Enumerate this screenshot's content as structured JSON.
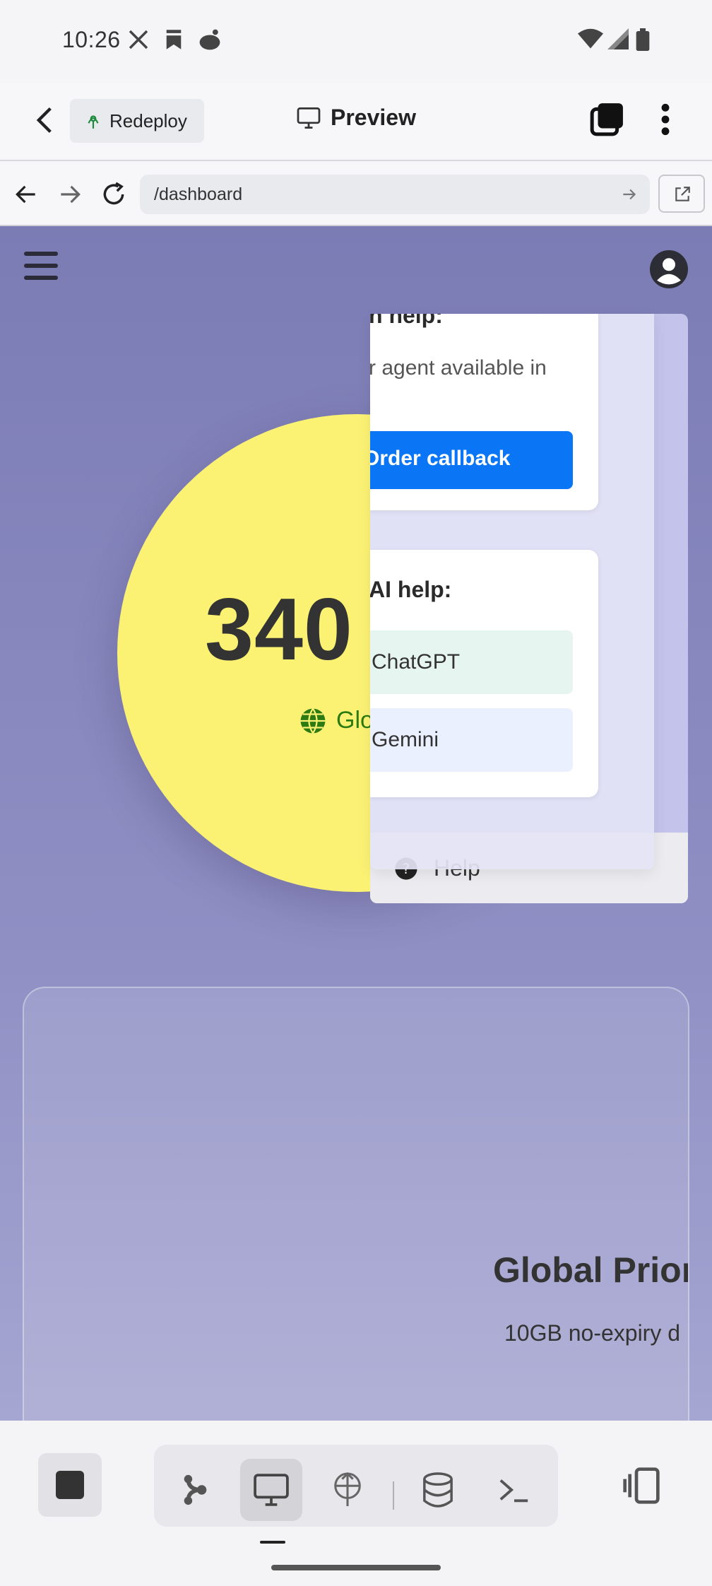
{
  "status_bar": {
    "time": "10:26",
    "notification_icons": [
      "x-icon",
      "bookmark-icon",
      "reddit-icon"
    ],
    "system_icons": [
      "wifi-icon",
      "signal-icon",
      "battery-icon"
    ]
  },
  "app_header": {
    "redeploy_label": "Redeploy",
    "title": "Preview"
  },
  "url_bar": {
    "url": "/dashboard"
  },
  "page": {
    "big_number": "340",
    "globe_label": "Glo",
    "menu_help_label": "Help",
    "help_panel": {
      "card1_title": "n help:",
      "card1_text": "r agent available in",
      "callback_button": "Order callback",
      "card2_title": "AI help:",
      "ai_options": [
        "ChatGPT",
        "Gemini"
      ]
    },
    "feature_title": "Global Prior",
    "feature_subtitle": "10GB no-expiry d"
  },
  "colors": {
    "accent_blue": "#0a76f6",
    "circle_yellow": "#fbf274",
    "page_purple": "#7c7cb5",
    "globe_green": "#2c7a12"
  }
}
